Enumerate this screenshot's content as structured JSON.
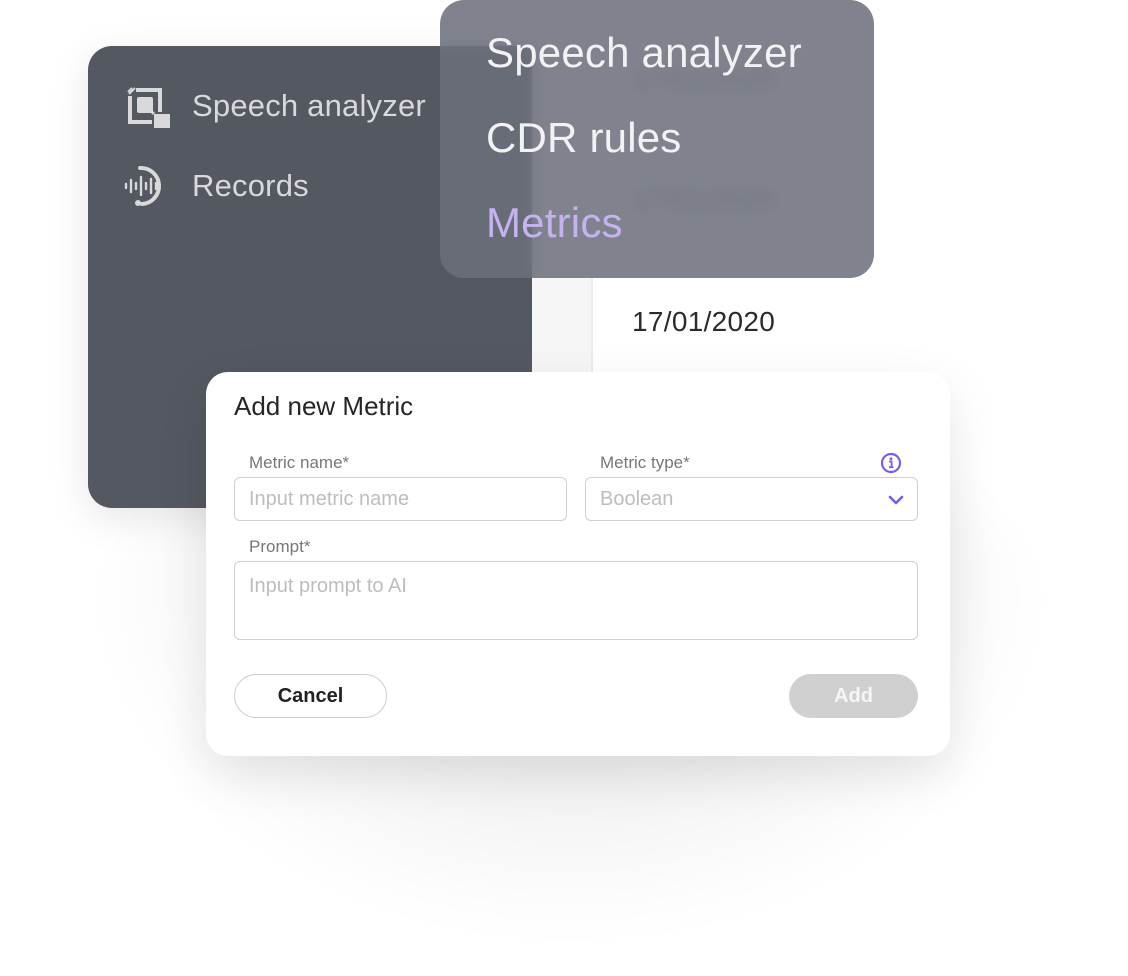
{
  "sidebar": {
    "items": [
      {
        "label": "Speech analyzer",
        "icon": "speech-analyzer-icon"
      },
      {
        "label": "Records",
        "icon": "records-waveform-icon"
      }
    ]
  },
  "table": {
    "dates": [
      "17/01/2020",
      "17/01/2020",
      "17/01/2020"
    ]
  },
  "nav_popup": {
    "items": [
      {
        "label": "Speech analyzer",
        "active": false
      },
      {
        "label": "CDR rules",
        "active": false
      },
      {
        "label": "Metrics",
        "active": true
      }
    ],
    "active_color": "#c4b3ee"
  },
  "dialog": {
    "title": "Add new Metric",
    "metric_name": {
      "label": "Metric name*",
      "value": "",
      "placeholder": "Input metric name"
    },
    "metric_type": {
      "label": "Metric type*",
      "selected": "Boolean",
      "info_icon": "info-icon"
    },
    "prompt": {
      "label": "Prompt*",
      "value": "",
      "placeholder": "Input prompt to AI"
    },
    "cancel_label": "Cancel",
    "add_label": "Add",
    "accent_color": "#7b5ce6"
  }
}
